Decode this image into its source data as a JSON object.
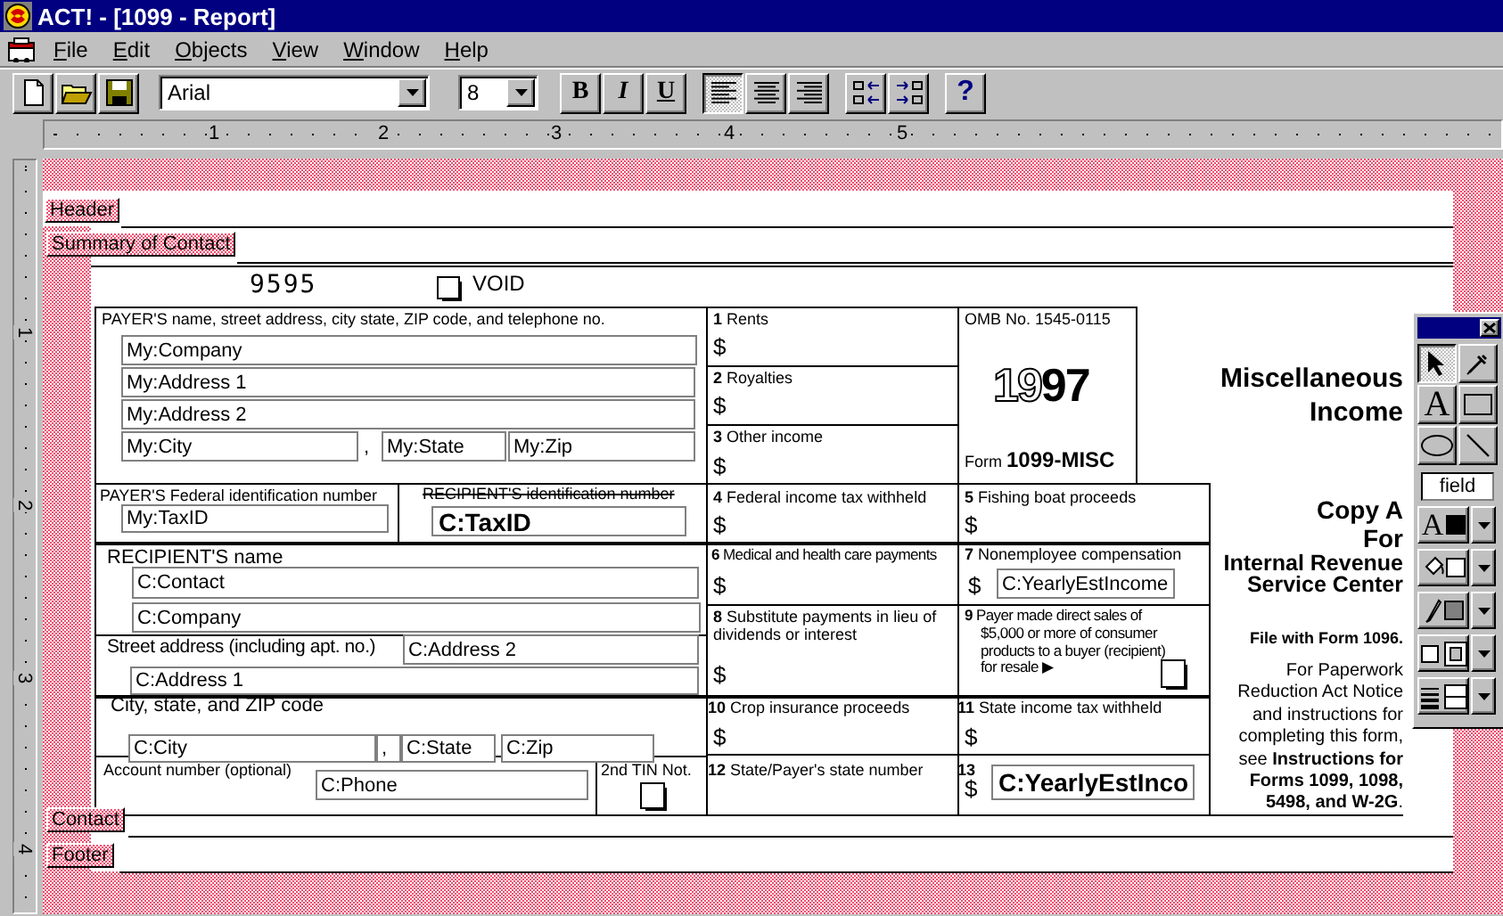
{
  "window": {
    "title": "ACT! - [1099 - Report]"
  },
  "menu": [
    {
      "label": "File"
    },
    {
      "label": "Edit"
    },
    {
      "label": "Objects"
    },
    {
      "label": "View"
    },
    {
      "label": "Window"
    },
    {
      "label": "Help"
    }
  ],
  "toolbar": {
    "font": "Arial",
    "size": "8",
    "style_buttons": [
      {
        "kind": "bold",
        "label": "B"
      },
      {
        "kind": "italic",
        "label": "I"
      },
      {
        "kind": "underline",
        "label": "U"
      }
    ],
    "align_buttons": [
      {
        "kind": "left",
        "selected": true
      },
      {
        "kind": "center",
        "selected": false
      },
      {
        "kind": "right",
        "selected": false
      }
    ],
    "help": "?"
  },
  "ruler": {
    "horizontal": [
      "1",
      "2",
      "3",
      "4",
      "5"
    ],
    "vertical": [
      "1",
      "2",
      "3",
      "4"
    ]
  },
  "bands": [
    {
      "label": "Header"
    },
    {
      "label": "Summary of Contact"
    },
    {
      "label": "Contact"
    },
    {
      "label": "Footer"
    }
  ],
  "form": {
    "items": [
      {
        "kind": "label",
        "text": "9595"
      },
      {
        "kind": "checkbox",
        "checked": false
      },
      {
        "kind": "label",
        "text": "VOID"
      },
      {
        "kind": "label",
        "text": "PAYER'S  name, street address, city state, ZIP code, and telephone no."
      },
      {
        "kind": "field",
        "text": "My:Company"
      },
      {
        "kind": "field",
        "text": "My:Address 1"
      },
      {
        "kind": "field",
        "text": "My:Address 2"
      },
      {
        "kind": "field",
        "text": "My:City"
      },
      {
        "kind": "label",
        "text": ","
      },
      {
        "kind": "field",
        "text": "My:State"
      },
      {
        "kind": "field",
        "text": "My:Zip"
      },
      {
        "kind": "label",
        "text": "PAYER'S Federal identification number"
      },
      {
        "kind": "field",
        "text": "My:TaxID"
      },
      {
        "kind": "label",
        "text": "RECIPIENT'S identification number"
      },
      {
        "kind": "field",
        "text": "**C:TaxID**"
      },
      {
        "kind": "label",
        "text": "RECIPIENT'S name"
      },
      {
        "kind": "field",
        "text": "C:Contact"
      },
      {
        "kind": "field",
        "text": "C:Company"
      },
      {
        "kind": "label",
        "text": "Street address (including apt. no.)"
      },
      {
        "kind": "field",
        "text": "C:Address 2"
      },
      {
        "kind": "field",
        "text": "C:Address 1"
      },
      {
        "kind": "label",
        "text": "City, state, and ZIP code"
      },
      {
        "kind": "field",
        "text": "C:City"
      },
      {
        "kind": "field",
        "text": ","
      },
      {
        "kind": "field",
        "text": "C:State"
      },
      {
        "kind": "field",
        "text": "C:Zip"
      },
      {
        "kind": "label",
        "text": "Account number (optional)"
      },
      {
        "kind": "field",
        "text": "C:Phone"
      },
      {
        "kind": "label",
        "text": "2nd TIN Not."
      },
      {
        "kind": "checkbox",
        "checked": false
      },
      {
        "kind": "label",
        "text": "**1** Rents"
      },
      {
        "kind": "label",
        "text": "$"
      },
      {
        "kind": "label",
        "text": "**2** Royalties"
      },
      {
        "kind": "label",
        "text": "$"
      },
      {
        "kind": "label",
        "text": "**3** Other income"
      },
      {
        "kind": "label",
        "text": "$"
      },
      {
        "kind": "label",
        "text": "**4** Federal income tax withheld"
      },
      {
        "kind": "label",
        "text": "$"
      },
      {
        "kind": "label",
        "text": "**6** Medical and health care payments"
      },
      {
        "kind": "label",
        "text": "$"
      },
      {
        "kind": "label",
        "text": "**8** Substitute payments in lieu of dividends or interest"
      },
      {
        "kind": "label",
        "text": "$"
      },
      {
        "kind": "label",
        "text": "**10** Crop insurance proceeds"
      },
      {
        "kind": "label",
        "text": "$"
      },
      {
        "kind": "label",
        "text": "**12** State/Payer's state number"
      },
      {
        "kind": "label",
        "text": "OMB No. 1545-0115"
      },
      {
        "kind": "label",
        "text": "**1997**"
      },
      {
        "kind": "label",
        "text": "Form **1099-MISC**"
      },
      {
        "kind": "label",
        "text": "**5** Fishing boat proceeds"
      },
      {
        "kind": "label",
        "text": "$"
      },
      {
        "kind": "label",
        "text": "**7** Nonemployee compensation"
      },
      {
        "kind": "label",
        "text": "$"
      },
      {
        "kind": "field",
        "text": "C:YearlyEstIncome"
      },
      {
        "kind": "label",
        "text": "**9** Payer made direct sales of $5,000 or more of consumer products to a buyer (recipient) for resale ▶"
      },
      {
        "kind": "checkbox",
        "checked": false
      },
      {
        "kind": "label",
        "text": "**11** State income tax withheld"
      },
      {
        "kind": "label",
        "text": "$"
      },
      {
        "kind": "label",
        "text": "**13**"
      },
      {
        "kind": "label",
        "text": "$"
      },
      {
        "kind": "field",
        "text": "**C:YearlyEstInco**"
      },
      {
        "kind": "label",
        "text": "**Miscellaneous**"
      },
      {
        "kind": "label",
        "text": "**Income**"
      },
      {
        "kind": "label",
        "text": "**Copy A**"
      },
      {
        "kind": "label",
        "text": "**For**"
      },
      {
        "kind": "label",
        "text": "**Internal Revenue**"
      },
      {
        "kind": "label",
        "text": "**Service Center**"
      },
      {
        "kind": "label",
        "text": "**File with Form 1096.**"
      },
      {
        "kind": "label",
        "text": "For Paperwork Reduction Act Notice and instructions for completing this form, see **Instructions for Forms 1099, 1098, 5498, and W-2G**."
      }
    ]
  },
  "toolbox": {
    "tools": [
      {
        "kind": "pointer",
        "selected": true
      },
      {
        "kind": "dropper",
        "selected": false
      },
      {
        "kind": "text",
        "label": "A",
        "selected": false
      },
      {
        "kind": "rectangle",
        "selected": false
      },
      {
        "kind": "ellipse",
        "selected": false
      },
      {
        "kind": "line",
        "selected": false
      },
      {
        "kind": "field",
        "label": "field",
        "selected": false
      }
    ],
    "styles": [
      {
        "kind": "text_color",
        "label": "A",
        "color": "#000000"
      },
      {
        "kind": "fill_color",
        "color": "#ffffff"
      },
      {
        "kind": "line_color",
        "color": "#808080"
      },
      {
        "kind": "frame"
      },
      {
        "kind": "line_style"
      }
    ]
  }
}
